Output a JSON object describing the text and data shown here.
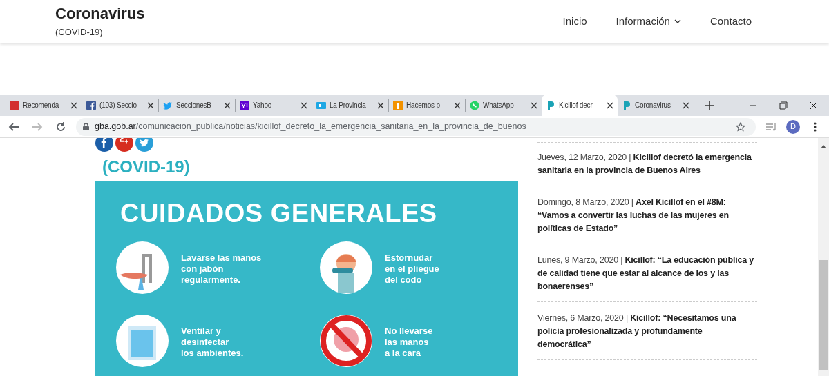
{
  "site_header": {
    "title": "Coronavirus",
    "subtitle": "(COVID-19)",
    "nav": [
      {
        "label": "Inicio",
        "has_dropdown": false
      },
      {
        "label": "Información",
        "has_dropdown": true
      },
      {
        "label": "Contacto",
        "has_dropdown": false
      }
    ]
  },
  "browser": {
    "tabs": [
      {
        "label": "Recomenda",
        "kind": "sb",
        "selected": false
      },
      {
        "label": "(103) Seccio",
        "kind": "facebook",
        "selected": false
      },
      {
        "label": "SeccionesB",
        "kind": "twitter",
        "selected": false
      },
      {
        "label": "Yahoo",
        "kind": "yahoo",
        "selected": false
      },
      {
        "label": "La Provincia",
        "kind": "provincia",
        "selected": false
      },
      {
        "label": "Hacemos p",
        "kind": "hacemos",
        "selected": false
      },
      {
        "label": "WhatsApp",
        "kind": "whatsapp",
        "selected": false
      },
      {
        "label": "Kicillof decr",
        "kind": "gba",
        "selected": true
      },
      {
        "label": "Coronavirus",
        "kind": "gba",
        "selected": false
      }
    ],
    "url": {
      "domain": "gba.gob.ar",
      "path": "/comunicacion_publica/noticias/kicillof_decretó_la_emergencia_sanitaria_en_la_provincia_de_buenos"
    },
    "profile_initial": "D"
  },
  "article": {
    "share_buttons": [
      {
        "kind": "facebook"
      },
      {
        "kind": "googleplus"
      },
      {
        "kind": "twitter"
      }
    ],
    "infographic": {
      "subtitle": "(COVID-19)",
      "title": "CUIDADOS GENERALES",
      "items": [
        {
          "text": "Lavarse las manos\ncon jabón\nregularmente.",
          "kind": "wash"
        },
        {
          "text": "Estornudar\nen el pliegue\ndel codo",
          "kind": "sneeze"
        },
        {
          "text": "Ventilar y\ndesinfectar\nlos ambientes.",
          "kind": "window"
        },
        {
          "text": "No llevarse\nlas manos\na la cara",
          "kind": "noface"
        }
      ]
    }
  },
  "sidebar": {
    "news": [
      {
        "text": "Jueves, 12 Marzo, 2020 | **Kicillof decretó la emergencia sanitaria en la provincia de Buenos Aires**"
      },
      {
        "text": "Domingo, 8 Marzo, 2020 | **Axel Kicillof en el #8M: “Vamos a convertir las luchas de las mujeres en políticas de Estado”**"
      },
      {
        "text": "Lunes, 9 Marzo, 2020 | **Kicillof: “La educación pública y de calidad tiene que estar al alcance de los y las bonaerenses”**"
      },
      {
        "text": "Viernes, 6 Marzo, 2020 | **Kicillof: “Necesitamos una policía profesionalizada y profundamente democrática”**"
      }
    ]
  }
}
